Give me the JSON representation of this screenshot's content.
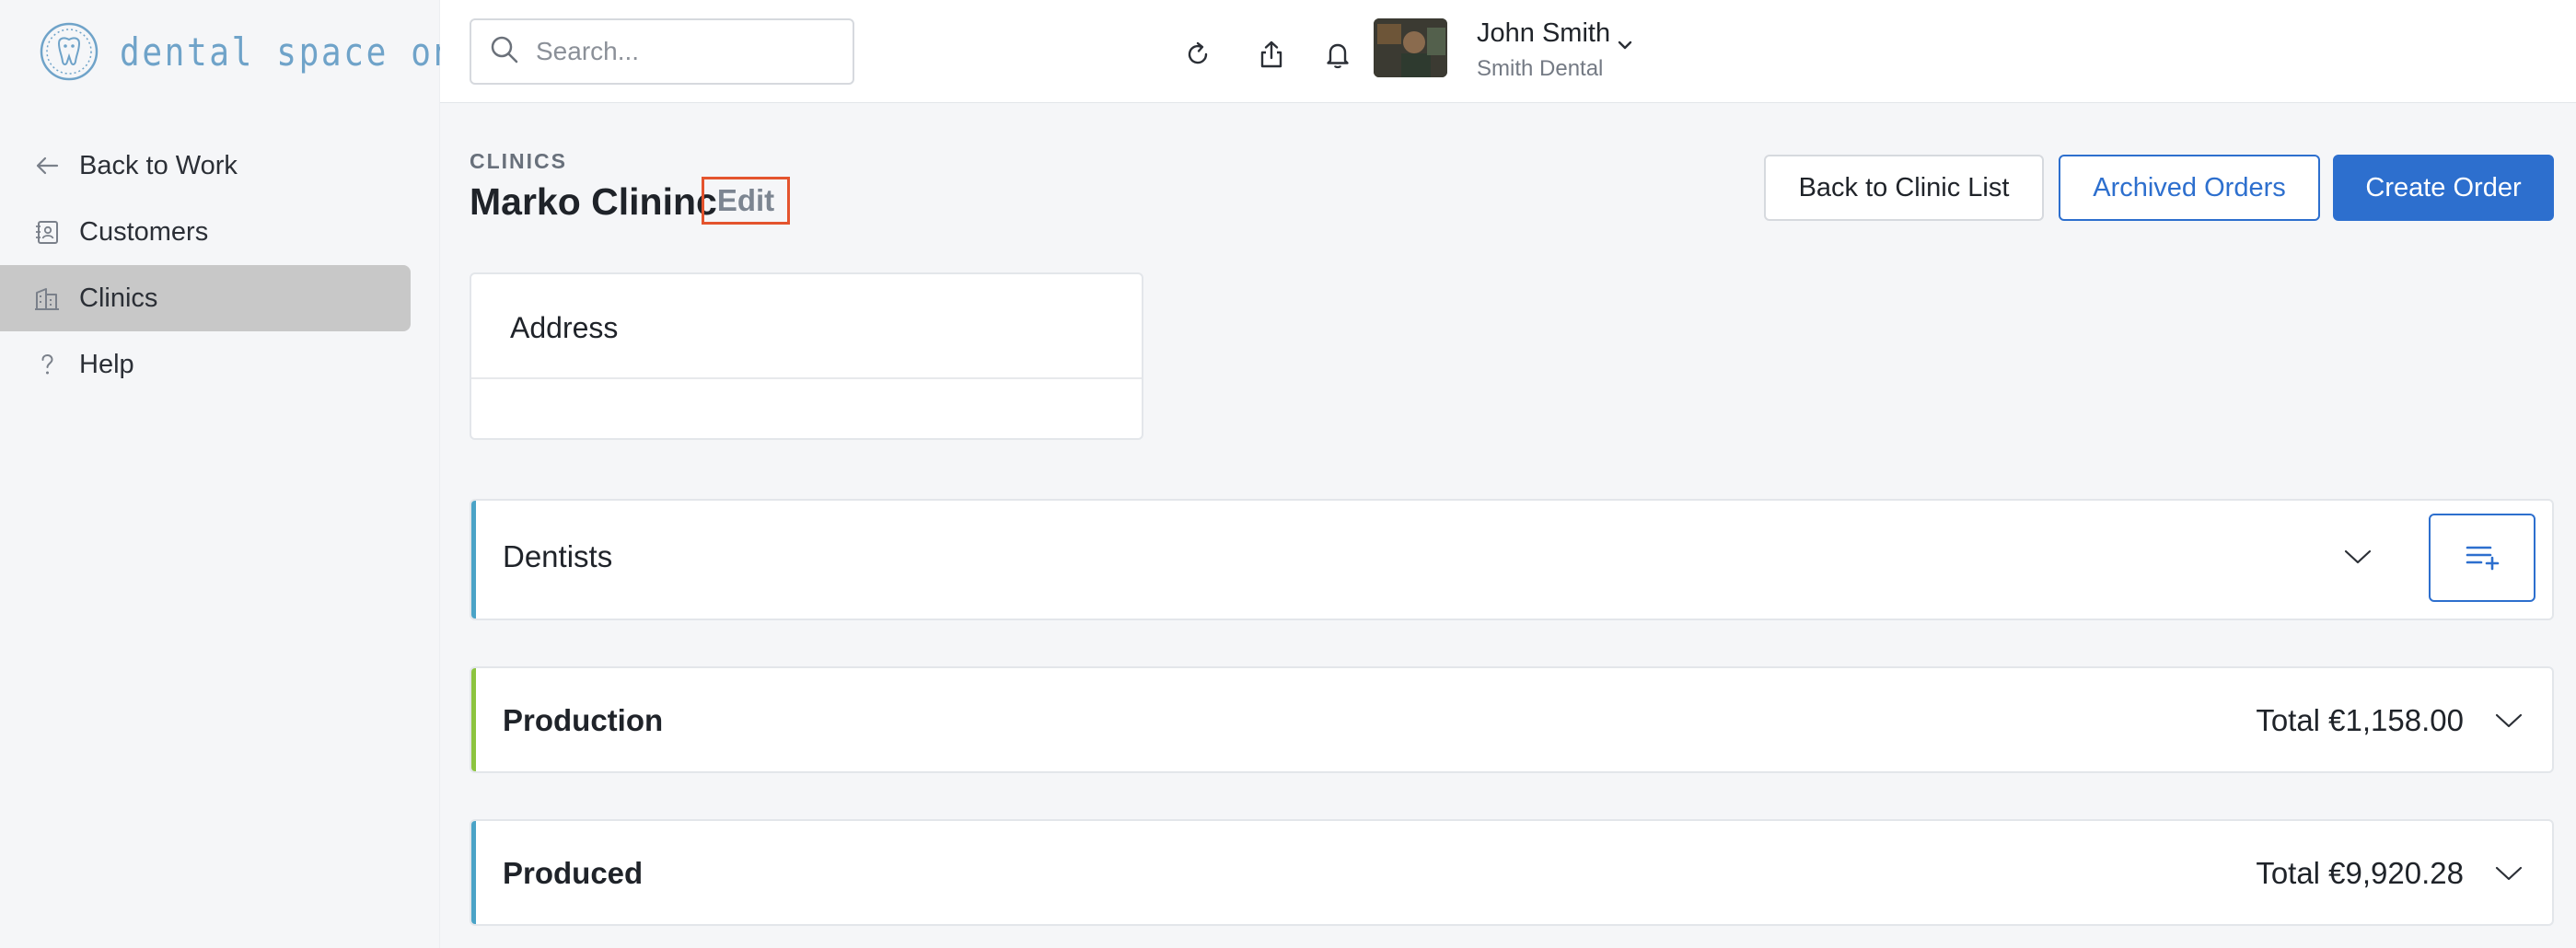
{
  "brand": {
    "logo_text": "dental space one"
  },
  "search": {
    "placeholder": "Search..."
  },
  "header": {
    "icons": [
      "refresh-icon",
      "share-icon",
      "bell-icon"
    ],
    "user": {
      "name": "John Smith",
      "company": "Smith Dental"
    }
  },
  "sidebar": {
    "items": [
      {
        "label": "Back to Work",
        "icon": "arrow-left-icon",
        "active": false
      },
      {
        "label": "Customers",
        "icon": "contacts-book-icon",
        "active": false
      },
      {
        "label": "Clinics",
        "icon": "building-icon",
        "active": true
      },
      {
        "label": "Help",
        "icon": "question-icon",
        "active": false
      }
    ]
  },
  "page": {
    "eyebrow": "CLINICS",
    "title": "Marko Clininc",
    "edit_label": "Edit"
  },
  "actions": {
    "back_label": "Back to Clinic List",
    "archived_label": "Archived Orders",
    "create_label": "Create Order"
  },
  "address": {
    "title": "Address"
  },
  "sections": {
    "dentists": {
      "title": "Dentists",
      "accent": "#4aa3c7"
    },
    "production": {
      "title": "Production",
      "total": "Total €1,158.00",
      "accent": "#8cc43f"
    },
    "produced": {
      "title": "Produced",
      "total": "Total €9,920.28",
      "accent": "#4aa3c7"
    }
  },
  "colors": {
    "primary": "#2d6fce",
    "highlight": "#e4542e",
    "active_nav": "#c8c8c8"
  }
}
